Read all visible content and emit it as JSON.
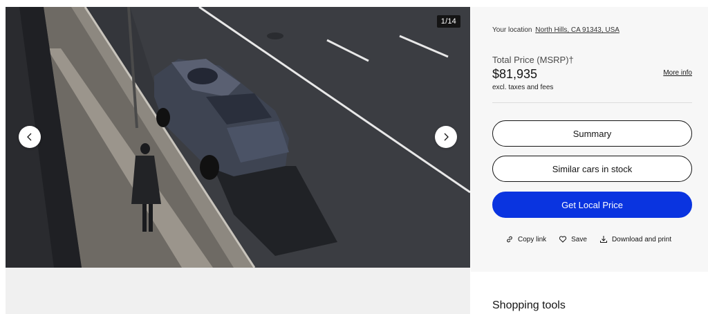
{
  "gallery": {
    "counter": "1/14",
    "prev_icon": "chevron-left-icon",
    "next_icon": "chevron-right-icon"
  },
  "panel": {
    "location_label": "Your location",
    "location_value": "North Hills, CA 91343, USA",
    "price_label": "Total Price (MSRP)†",
    "price_value": "$81,935",
    "price_note": "excl. taxes and fees",
    "more_info": "More info",
    "buttons": {
      "summary": "Summary",
      "similar": "Similar cars in stock",
      "local_price": "Get Local Price"
    },
    "actions": {
      "copy_link": "Copy link",
      "save": "Save",
      "download": "Download and print"
    }
  },
  "shopping_tools": {
    "title": "Shopping tools"
  },
  "colors": {
    "primary": "#0a34e0",
    "panel_bg": "#f7f7f7"
  }
}
